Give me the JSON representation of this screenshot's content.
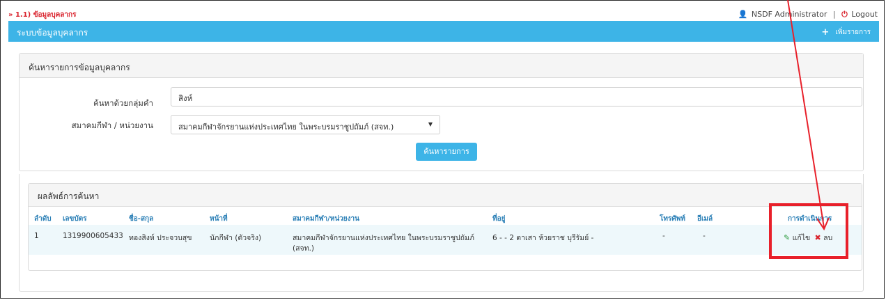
{
  "topbar": {
    "breadcrumb": "» 1.1) ข้อมูลบุคลากร",
    "username": "NSDF Administrator",
    "separator": "|",
    "logout": "Logout",
    "user_icon": "person-icon",
    "logout_icon": "power-icon"
  },
  "header": {
    "title": "ระบบข้อมูลบุคลากร",
    "add_icon": "plus-icon",
    "add_label": "เพิ่มรายการ"
  },
  "search": {
    "panel_title": "ค้นหารายการข้อมูลบุคลากร",
    "keyword_label": "ค้นหาด้วยกลุ่มคำ",
    "keyword_value": "สิงห์",
    "assoc_label": "สมาคมกีฬา / หน่วยงาน",
    "assoc_value": "สมาคมกีฬาจักรยานแห่งประเทศไทย ในพระบรมราชูปถัมภ์ (สจท.)",
    "button_label": "ค้นหารายการ"
  },
  "results": {
    "panel_title": "ผลลัพธ์การค้นหา",
    "headers": [
      "ลำดับ",
      "เลขบัตร",
      "ชื่อ-สกุล",
      "หน้าที่",
      "สมาคมกีฬา/หน่วยงาน",
      "ที่อยู่",
      "โทรศัพท์",
      "อีเมล์",
      "การดำเนินการ"
    ],
    "rows": [
      {
        "no": "1",
        "id": "1319900605433",
        "name": "ทองสิงห์ ประจวบสุข",
        "role": "นักกีฬา (ตัวจริง)",
        "assoc_line1": "สมาคมกีฬาจักรยานแห่งประเทศไทย ในพระบรมราชูปถัมภ์",
        "assoc_line2": "(สจท.)",
        "address": "6 - - 2 ตาเสา ห้วยราช บุรีรัมย์ -",
        "phone": "-",
        "email": "-",
        "edit_label": "แก้ไข",
        "delete_label": "ลบ"
      }
    ]
  },
  "colors": {
    "primary": "#3db4e7",
    "danger": "#d9232d",
    "success": "#2e9b3f",
    "annotation": "#e8202a"
  }
}
